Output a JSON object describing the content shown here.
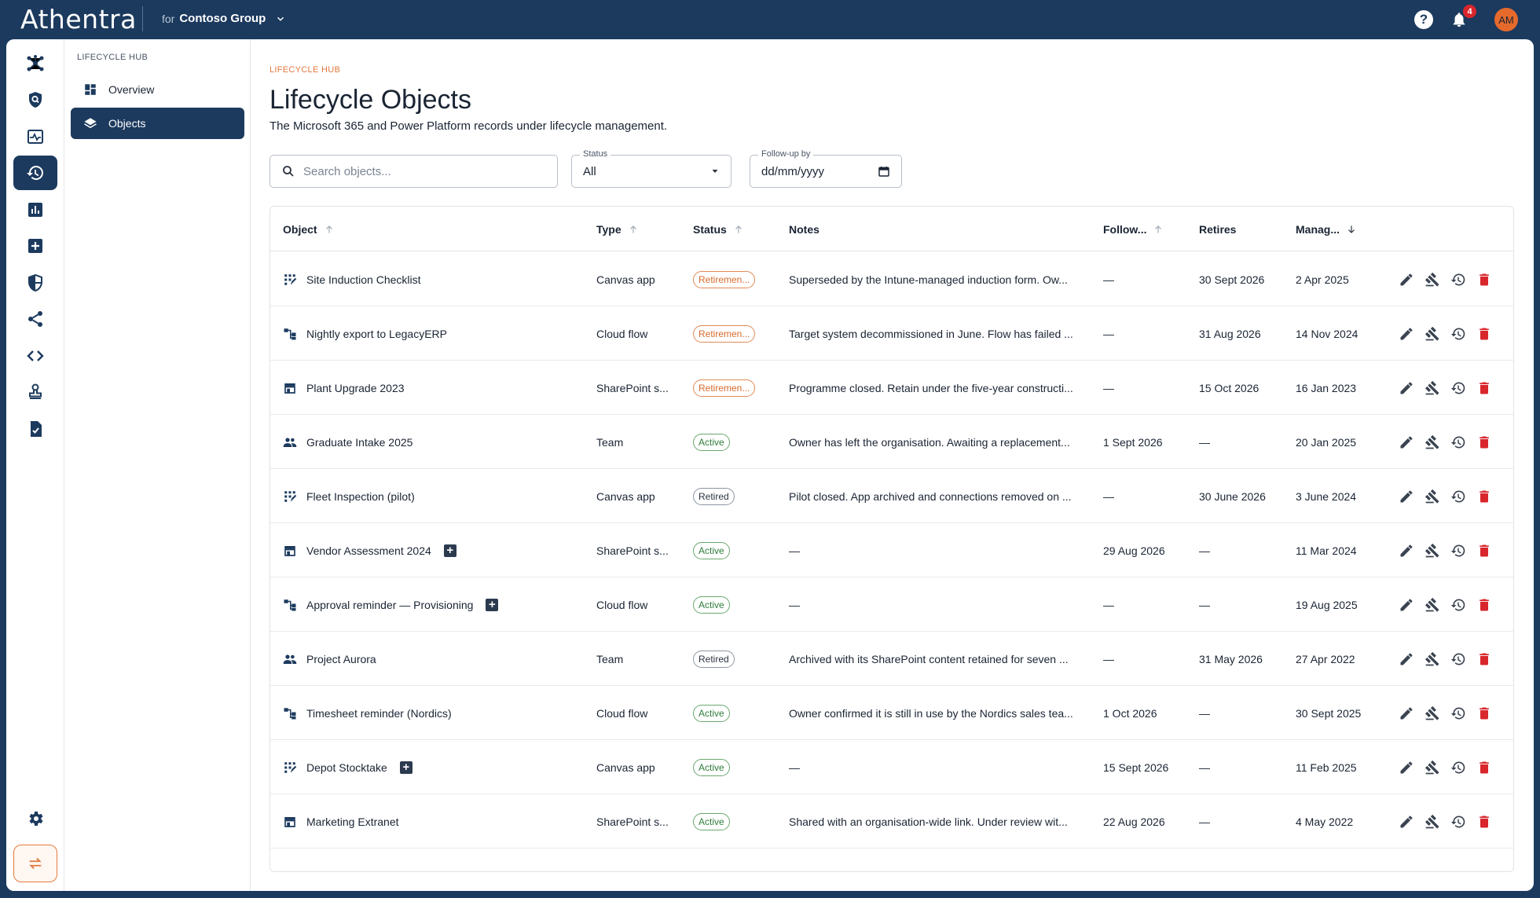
{
  "app": {
    "brand": "Athentra",
    "tenant_prefix": "for",
    "tenant_name": "Contoso Group",
    "notifications_count": "4",
    "user_initials": "AM"
  },
  "subnav": {
    "heading": "LIFECYCLE HUB",
    "items": [
      {
        "label": "Overview",
        "icon": "dashboard-icon",
        "active": false
      },
      {
        "label": "Objects",
        "icon": "layers-icon",
        "active": true
      }
    ]
  },
  "page": {
    "eyebrow": "LIFECYCLE HUB",
    "title": "Lifecycle Objects",
    "subtitle": "The Microsoft 365 and Power Platform records under lifecycle management."
  },
  "filters": {
    "search_placeholder": "Search objects...",
    "status_label": "Status",
    "status_value": "All",
    "followup_label": "Follow-up by",
    "followup_placeholder": "dd/mm/yyyy"
  },
  "table": {
    "columns": {
      "object": "Object",
      "type": "Type",
      "status": "Status",
      "notes": "Notes",
      "followup": "Follow...",
      "retires": "Retires",
      "managed": "Manag..."
    },
    "rows": [
      {
        "icon": "canvas-app-icon",
        "name": "Site Induction Checklist",
        "new": false,
        "type": "Canvas app",
        "status": "Retiremen...",
        "status_kind": "retirement",
        "notes": "Superseded by the Intune-managed induction form. Ow...",
        "followup": "—",
        "retires": "30 Sept 2026",
        "managed": "2 Apr 2025"
      },
      {
        "icon": "cloud-flow-icon",
        "name": "Nightly export to LegacyERP",
        "new": false,
        "type": "Cloud flow",
        "status": "Retiremen...",
        "status_kind": "retirement",
        "notes": "Target system decommissioned in June. Flow has failed ...",
        "followup": "—",
        "retires": "31 Aug 2026",
        "managed": "14 Nov 2024"
      },
      {
        "icon": "sharepoint-site-icon",
        "name": "Plant Upgrade 2023",
        "new": false,
        "type": "SharePoint s...",
        "status": "Retiremen...",
        "status_kind": "retirement",
        "notes": "Programme closed. Retain under the five-year constructi...",
        "followup": "—",
        "retires": "15 Oct 2026",
        "managed": "16 Jan 2023"
      },
      {
        "icon": "team-icon",
        "name": "Graduate Intake 2025",
        "new": false,
        "type": "Team",
        "status": "Active",
        "status_kind": "active",
        "notes": "Owner has left the organisation. Awaiting a replacement...",
        "followup": "1 Sept 2026",
        "retires": "—",
        "managed": "20 Jan 2025"
      },
      {
        "icon": "canvas-app-icon",
        "name": "Fleet Inspection (pilot)",
        "new": false,
        "type": "Canvas app",
        "status": "Retired",
        "status_kind": "retired",
        "notes": "Pilot closed. App archived and connections removed on ...",
        "followup": "—",
        "retires": "30 June 2026",
        "managed": "3 June 2024"
      },
      {
        "icon": "sharepoint-site-icon",
        "name": "Vendor Assessment 2024",
        "new": true,
        "type": "SharePoint s...",
        "status": "Active",
        "status_kind": "active",
        "notes": "—",
        "followup": "29 Aug 2026",
        "retires": "—",
        "managed": "11 Mar 2024"
      },
      {
        "icon": "cloud-flow-icon",
        "name": "Approval reminder — Provisioning",
        "new": true,
        "type": "Cloud flow",
        "status": "Active",
        "status_kind": "active",
        "notes": "—",
        "followup": "—",
        "retires": "—",
        "managed": "19 Aug 2025"
      },
      {
        "icon": "team-icon",
        "name": "Project Aurora",
        "new": false,
        "type": "Team",
        "status": "Retired",
        "status_kind": "retired",
        "notes": "Archived with its SharePoint content retained for seven ...",
        "followup": "—",
        "retires": "31 May 2026",
        "managed": "27 Apr 2022"
      },
      {
        "icon": "cloud-flow-icon",
        "name": "Timesheet reminder (Nordics)",
        "new": false,
        "type": "Cloud flow",
        "status": "Active",
        "status_kind": "active",
        "notes": "Owner confirmed it is still in use by the Nordics sales tea...",
        "followup": "1 Oct 2026",
        "retires": "—",
        "managed": "30 Sept 2025"
      },
      {
        "icon": "canvas-app-icon",
        "name": "Depot Stocktake",
        "new": true,
        "type": "Canvas app",
        "status": "Active",
        "status_kind": "active",
        "notes": "—",
        "followup": "15 Sept 2026",
        "retires": "—",
        "managed": "11 Feb 2025"
      },
      {
        "icon": "sharepoint-site-icon",
        "name": "Marketing Extranet",
        "new": false,
        "type": "SharePoint s...",
        "status": "Active",
        "status_kind": "active",
        "notes": "Shared with an organisation-wide link. Under review wit...",
        "followup": "22 Aug 2026",
        "retires": "—",
        "managed": "4 May 2022"
      }
    ]
  },
  "colors": {
    "navy": "#1c3a5e",
    "accent_orange": "#e0783f",
    "active_green": "#2e7d3a",
    "delete_red": "#d8262c"
  }
}
